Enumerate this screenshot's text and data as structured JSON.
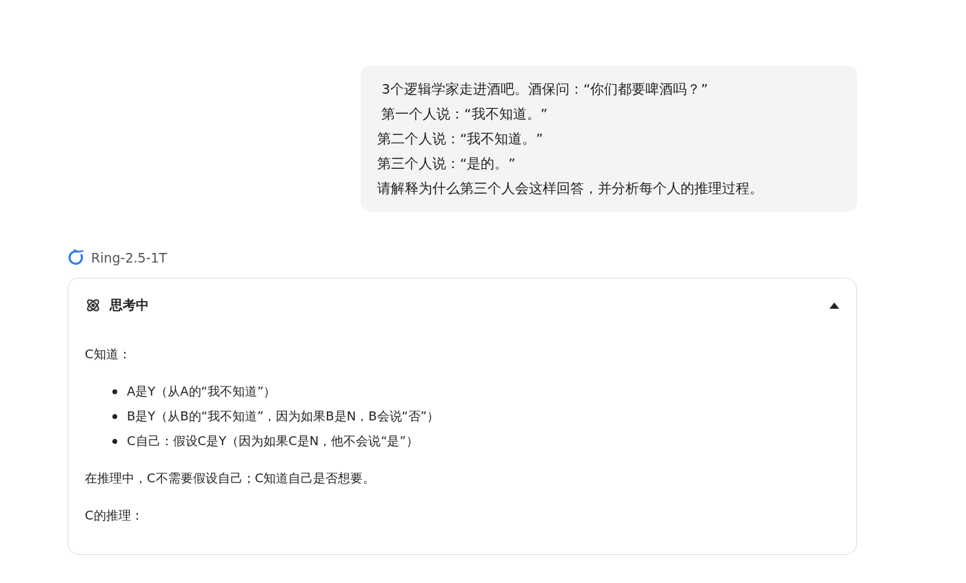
{
  "user_message": {
    "lines": [
      " 3个逻辑学家走进酒吧。酒保问：“你们都要啤酒吗？”",
      " 第一个人说：“我不知道。”",
      "第二个人说：“我不知道。”",
      "第三个人说：“是的。”",
      "请解释为什么第三个人会这样回答，并分析每个人的推理过程。"
    ]
  },
  "assistant": {
    "model_name": "Ring-2.5-1T",
    "thinking": {
      "title": "思考中",
      "expanded": true,
      "blocks": [
        {
          "kind": "paragraph",
          "text": "C知道："
        },
        {
          "kind": "list",
          "items": [
            "A是Y（从A的“我不知道”）",
            "B是Y（从B的“我不知道”，因为如果B是N，B会说“否”）",
            "C自己：假设C是Y（因为如果C是N，他不会说“是”）"
          ]
        },
        {
          "kind": "paragraph",
          "text": "在推理中，C不需要假设自己；C知道自己是否想要。"
        },
        {
          "kind": "paragraph",
          "text": "C的推理："
        }
      ]
    }
  }
}
